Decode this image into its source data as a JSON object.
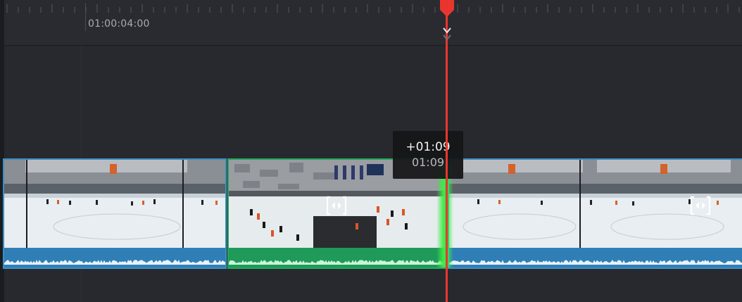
{
  "ruler": {
    "timecode": "01:00:04:00"
  },
  "trim_tooltip": {
    "delta": "+01:09",
    "duration": "01:09"
  },
  "icons": {
    "playhead": "playhead-marker-icon",
    "snap": "snap-chevron-icon",
    "transition": "transition-handle-icon"
  },
  "colors": {
    "playhead": "#e8362e",
    "selected_clip": "#23a85f",
    "clip_border": "#3d8ec2",
    "audio_track": "#2f7fb6",
    "trim_highlight": "#3ceb46"
  }
}
